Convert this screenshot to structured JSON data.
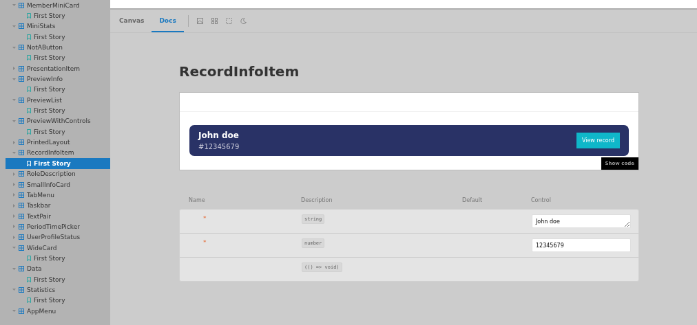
{
  "sidebar": {
    "items": [
      {
        "label": "MemberMiniCard",
        "expanded": true,
        "children": [
          {
            "label": "First Story",
            "selected": false
          }
        ]
      },
      {
        "label": "MiniStats",
        "expanded": true,
        "children": [
          {
            "label": "First Story",
            "selected": false
          }
        ]
      },
      {
        "label": "NotAButton",
        "expanded": true,
        "children": [
          {
            "label": "First Story",
            "selected": false
          }
        ]
      },
      {
        "label": "PresentationItem",
        "expanded": false
      },
      {
        "label": "PreviewInfo",
        "expanded": true,
        "children": [
          {
            "label": "First Story",
            "selected": false
          }
        ]
      },
      {
        "label": "PreviewList",
        "expanded": true,
        "children": [
          {
            "label": "First Story",
            "selected": false
          }
        ]
      },
      {
        "label": "PreviewWithControls",
        "expanded": true,
        "children": [
          {
            "label": "First Story",
            "selected": false
          }
        ]
      },
      {
        "label": "PrintedLayout",
        "expanded": false
      },
      {
        "label": "RecordInfoItem",
        "expanded": true,
        "children": [
          {
            "label": "First Story",
            "selected": true
          }
        ]
      },
      {
        "label": "RoleDescription",
        "expanded": false
      },
      {
        "label": "SmallInfoCard",
        "expanded": false
      },
      {
        "label": "TabMenu",
        "expanded": false
      },
      {
        "label": "Taskbar",
        "expanded": false
      },
      {
        "label": "TextPair",
        "expanded": false
      },
      {
        "label": "PeriodTimePicker",
        "expanded": false
      },
      {
        "label": "UserProfileStatus",
        "expanded": false
      },
      {
        "label": "WideCard",
        "expanded": true,
        "children": [
          {
            "label": "First Story",
            "selected": false
          }
        ]
      },
      {
        "label": "Data",
        "expanded": true,
        "children": [
          {
            "label": "First Story",
            "selected": false
          }
        ]
      },
      {
        "label": "Statistics",
        "expanded": true,
        "children": [
          {
            "label": "First Story",
            "selected": false
          }
        ]
      },
      {
        "label": "AppMenu",
        "expanded": true
      }
    ]
  },
  "tabs": [
    {
      "label": "Canvas",
      "selected": false
    },
    {
      "label": "Docs",
      "selected": true
    }
  ],
  "title": "RecordInfoItem",
  "preview": {
    "name": "John doe",
    "number": "#12345679",
    "button": "View record",
    "show_code": "Show code"
  },
  "props_table": {
    "columns": [
      "Name",
      "Description",
      "Default",
      "Control"
    ],
    "rows": [
      {
        "mark": "*",
        "type": "string",
        "kind": "textarea",
        "value": "John doe"
      },
      {
        "mark": "*",
        "type": "number",
        "kind": "input",
        "value": "12345679"
      },
      {
        "type": "(() => void)",
        "kind": "none"
      }
    ]
  }
}
